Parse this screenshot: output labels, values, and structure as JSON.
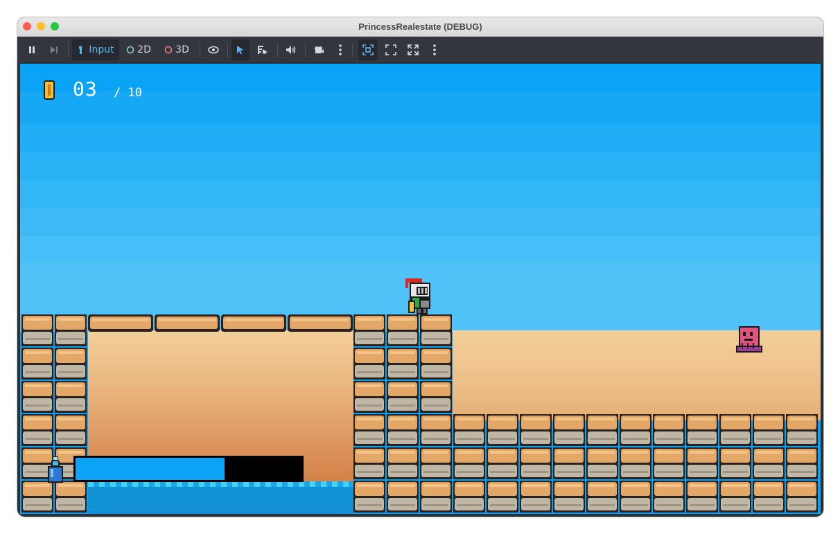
{
  "window": {
    "title": "PrincessRealestate (DEBUG)"
  },
  "toolbar": {
    "items": [
      {
        "name": "pause-icon"
      },
      {
        "name": "next-frame-icon"
      },
      {
        "name": "input-toggle",
        "label": "Input"
      },
      {
        "name": "2d-toggle",
        "label": "2D"
      },
      {
        "name": "3d-toggle",
        "label": "3D"
      },
      {
        "name": "visibility-icon"
      },
      {
        "name": "select-icon"
      },
      {
        "name": "list-select-icon"
      },
      {
        "name": "speaker-icon"
      },
      {
        "name": "camera-icon"
      },
      {
        "name": "more-icon"
      },
      {
        "name": "focus-icon"
      },
      {
        "name": "fullscreen-icon"
      },
      {
        "name": "expand-icon"
      },
      {
        "name": "more-icon"
      }
    ]
  },
  "hud": {
    "coins": "03",
    "total": "/ 10",
    "meter_fraction": 0.66
  },
  "colors": {
    "sky": "#0aa3f5",
    "water": "#1190d6",
    "meter": "#0aa3f5"
  }
}
